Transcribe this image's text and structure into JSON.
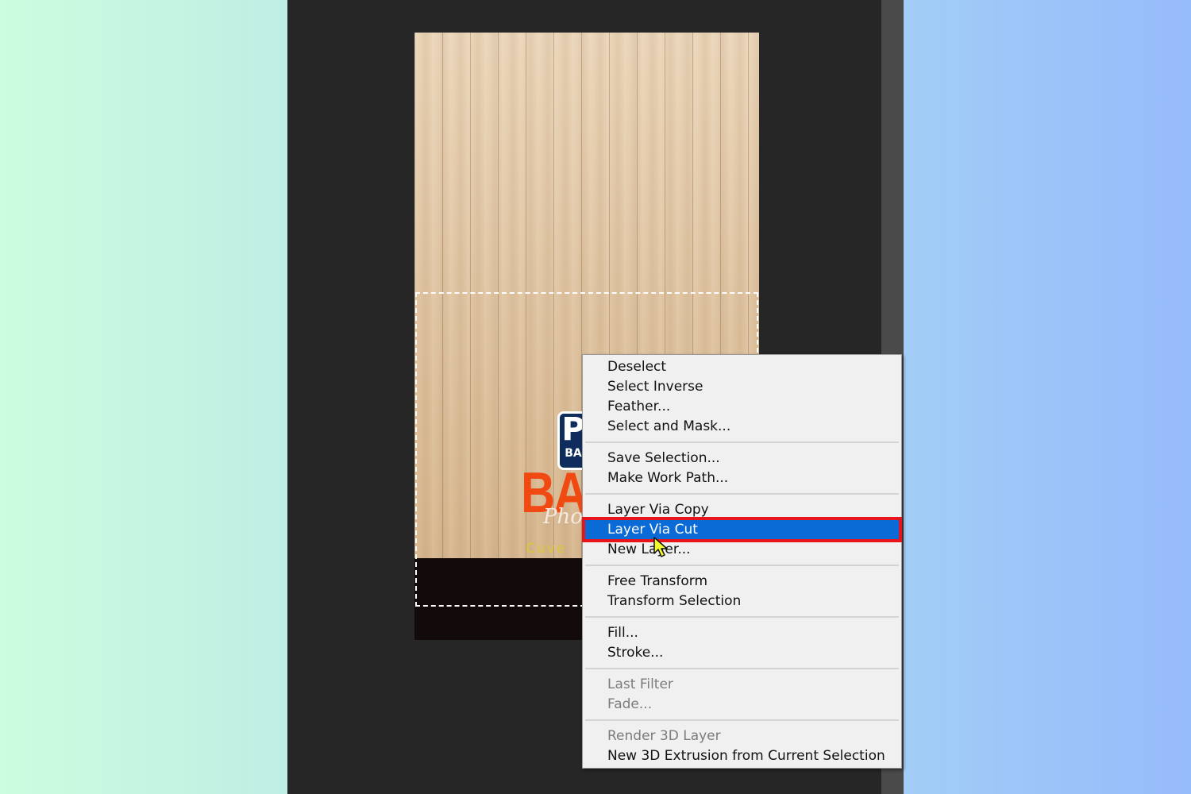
{
  "context_menu": {
    "items": [
      {
        "label": "Deselect",
        "state": "enabled"
      },
      {
        "label": "Select Inverse",
        "state": "enabled"
      },
      {
        "label": "Feather...",
        "state": "enabled"
      },
      {
        "label": "Select and Mask...",
        "state": "enabled"
      },
      {
        "label": "Save Selection...",
        "state": "enabled"
      },
      {
        "label": "Make Work Path...",
        "state": "enabled"
      },
      {
        "label": "Layer Via Copy",
        "state": "enabled"
      },
      {
        "label": "Layer Via Cut",
        "state": "highlighted"
      },
      {
        "label": "New Layer...",
        "state": "enabled"
      },
      {
        "label": "Free Transform",
        "state": "enabled"
      },
      {
        "label": "Transform Selection",
        "state": "enabled"
      },
      {
        "label": "Fill...",
        "state": "enabled"
      },
      {
        "label": "Stroke...",
        "state": "enabled"
      },
      {
        "label": "Last Filter",
        "state": "disabled"
      },
      {
        "label": "Fade...",
        "state": "disabled"
      },
      {
        "label": "Render 3D Layer",
        "state": "disabled"
      },
      {
        "label": "New 3D Extrusion from Current Selection",
        "state": "enabled"
      }
    ]
  },
  "canvas": {
    "logo_badge_letter": "P",
    "logo_badge_sub": "BA",
    "logo_big_text": "BAF",
    "logo_script_text": "Pho",
    "logo_small_text": "Cuve"
  },
  "colors": {
    "highlight": "#0a6ad6",
    "annotation_frame": "#e8141b",
    "workspace": "#262626",
    "menu_bg": "#f0f0f0"
  },
  "icons": {
    "cursor": "arrow-pointer-icon"
  }
}
